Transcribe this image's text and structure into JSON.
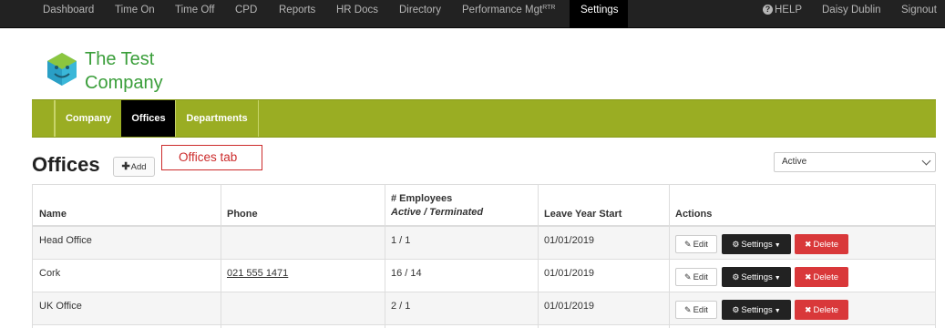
{
  "topnav": {
    "items": [
      "Dashboard",
      "Time On",
      "Time Off",
      "CPD",
      "Reports",
      "HR Docs",
      "Directory"
    ],
    "performance": {
      "label": "Performance Mgt",
      "sup": "RTR"
    },
    "settings": "Settings",
    "help": "HELP",
    "user": "Daisy Dublin",
    "signout": "Signout"
  },
  "logo": {
    "line1": "The Test",
    "line2": "Company",
    "icon": "company-logo-icon"
  },
  "subnav": {
    "tabs": [
      "Company",
      "Offices",
      "Departments"
    ],
    "active": "Offices"
  },
  "page": {
    "title": "Offices",
    "add_label": "Add",
    "callout": "Offices tab"
  },
  "filter": {
    "selected": "Active"
  },
  "table": {
    "headers": {
      "name": "Name",
      "phone": "Phone",
      "employees": "# Employees",
      "employees_sub": "Active / Terminated",
      "leave": "Leave Year Start",
      "actions": "Actions"
    },
    "rows": [
      {
        "name": "Head Office",
        "phone": "",
        "employees": "1 / 1",
        "leave": "01/01/2019"
      },
      {
        "name": "Cork",
        "phone": "021 555 1471",
        "employees": "16 / 14",
        "leave": "01/01/2019"
      },
      {
        "name": "UK Office",
        "phone": "",
        "employees": "2 / 1",
        "leave": "01/01/2019"
      }
    ],
    "actions": {
      "edit": "Edit",
      "settings": "Settings",
      "delete": "Delete"
    }
  },
  "colors": {
    "nav_bg": "#222222",
    "accent": "#9aad23",
    "logo_green": "#3a9e3a",
    "delete_red": "#d9383a",
    "callout_red": "#cc2b2b"
  }
}
